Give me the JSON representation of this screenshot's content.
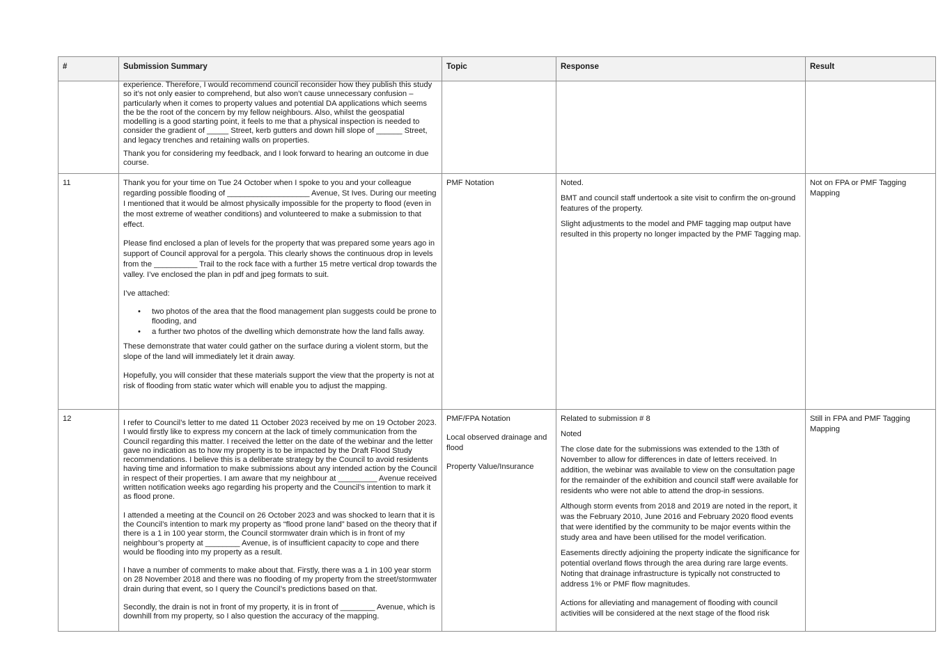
{
  "table": {
    "headers": [
      "#",
      "Submission Summary",
      "Topic",
      "Response",
      "Result"
    ],
    "rows": [
      {
        "number": "",
        "summary": [
          "experience. Therefore, I would recommend council reconsider how they publish this study so it’s not only easier to comprehend, but also won’t cause unnecessary confusion – particularly when it comes to property values and potential DA applications which seems the be the root of the concern by my fellow neighbours. Also, whilst the geospatial modelling is a good starting point, it feels to me that a physical inspection is needed to consider the gradient of _____ Street, kerb gutters and down hill slope of ______ Street, and legacy trenches and retaining walls on properties.",
          "Thank you for considering my feedback, and I look forward to hearing an outcome in due course."
        ],
        "topic": [],
        "response": [],
        "result": ""
      },
      {
        "number": "11",
        "summary": [
          "Thank you for your time on Tue 24 October when I spoke to you and your colleague regarding possible flooding of ___________________ Avenue, St Ives. During our meeting I mentioned that it would be almost physically impossible for the property to flood (even in the most extreme of weather conditions) and volunteered to make a submission to that effect.",
          "Please find enclosed a plan of levels for the property that was prepared some years ago in support of Council approval for a pergola. This clearly shows the continuous drop in levels from the __________ Trail to the rock face with a further 15 metre vertical drop towards the valley. I’ve enclosed the plan in pdf and jpeg formats to suit.",
          "I’ve attached:",
          "These demonstrate that water could gather on the surface during a violent storm, but the slope of the land will immediately let it drain away.",
          "Hopefully, you will consider that these materials support the view that the property is not at risk of flooding from static water which will enable you to adjust the mapping."
        ],
        "bullets": [
          "two photos of the area that the flood management plan suggests could be prone to flooding, and",
          "a further two photos of the dwelling which demonstrate how the land falls away."
        ],
        "topic": [
          "PMF Notation"
        ],
        "response": [
          "Noted.",
          "BMT and council staff undertook a site visit to confirm the on-ground features of the property.",
          "Slight adjustments to the model and PMF tagging map output have resulted in this property no longer impacted by the PMF Tagging map."
        ],
        "result": "Not on FPA or PMF Tagging Mapping"
      },
      {
        "number": "12",
        "summary": [
          "I refer to Council’s letter to me dated 11 October 2023 received by me on 19 October 2023. I would firstly like to express my concern at the lack of timely communication from the Council regarding this matter. I received the letter on the date of the webinar and the letter gave no indication as to how my property is to be impacted by the Draft Flood Study recommendations. I believe this is a deliberate strategy by the Council to avoid residents having time and information to make submissions about any intended action by the Council in respect of their properties. I am aware that my neighbour at _________ Avenue received written notification weeks ago regarding his property and the Council’s intention to mark it as flood prone.",
          "I attended a meeting at the Council on 26 October 2023 and was shocked to learn that it is the Council’s intention to mark my property as “flood prone land” based on the theory that if there is a 1 in 100 year storm, the Council stormwater drain which is in front of my neighbour’s property at ________ Avenue, is of insufficient capacity to cope and there would be flooding into my property as a result.",
          "I have a number of comments to make about that. Firstly, there was a 1 in 100 year storm on 28 November 2018 and there was no flooding of my property from the street/stormwater drain during that event, so I query the Council’s predictions based on that.",
          "Secondly, the drain is not in front of my property, it is in front of ________ Avenue, which is downhill from my property, so I also question the accuracy of the mapping."
        ],
        "topic": [
          "PMF/FPA Notation",
          "Local observed drainage and flood",
          "Property Value/Insurance"
        ],
        "response": [
          "Related to submission # 8",
          "Noted",
          "The close date for the submissions was extended to the 13th of November to allow for differences in date of letters received. In addition, the webinar was available to view on the consultation page for the remainder of the exhibition and council staff were available for residents who were not able to attend the drop-in sessions.",
          "Although storm events from 2018 and 2019 are noted in the report, it was the February 2010, June 2016 and February 2020 flood events that were identified by the community to be major events within the study area and have been utilised for the model verification.",
          "Easements directly adjoining the property indicate the significance for potential overland flows through the area during rare large events. Noting that drainage infrastructure is typically not constructed to address 1% or PMF flow magnitudes.",
          "Actions for alleviating and management of flooding with council activities will be considered at the next stage of the flood risk"
        ],
        "result": "Still in FPA and PMF Tagging Mapping"
      }
    ]
  }
}
